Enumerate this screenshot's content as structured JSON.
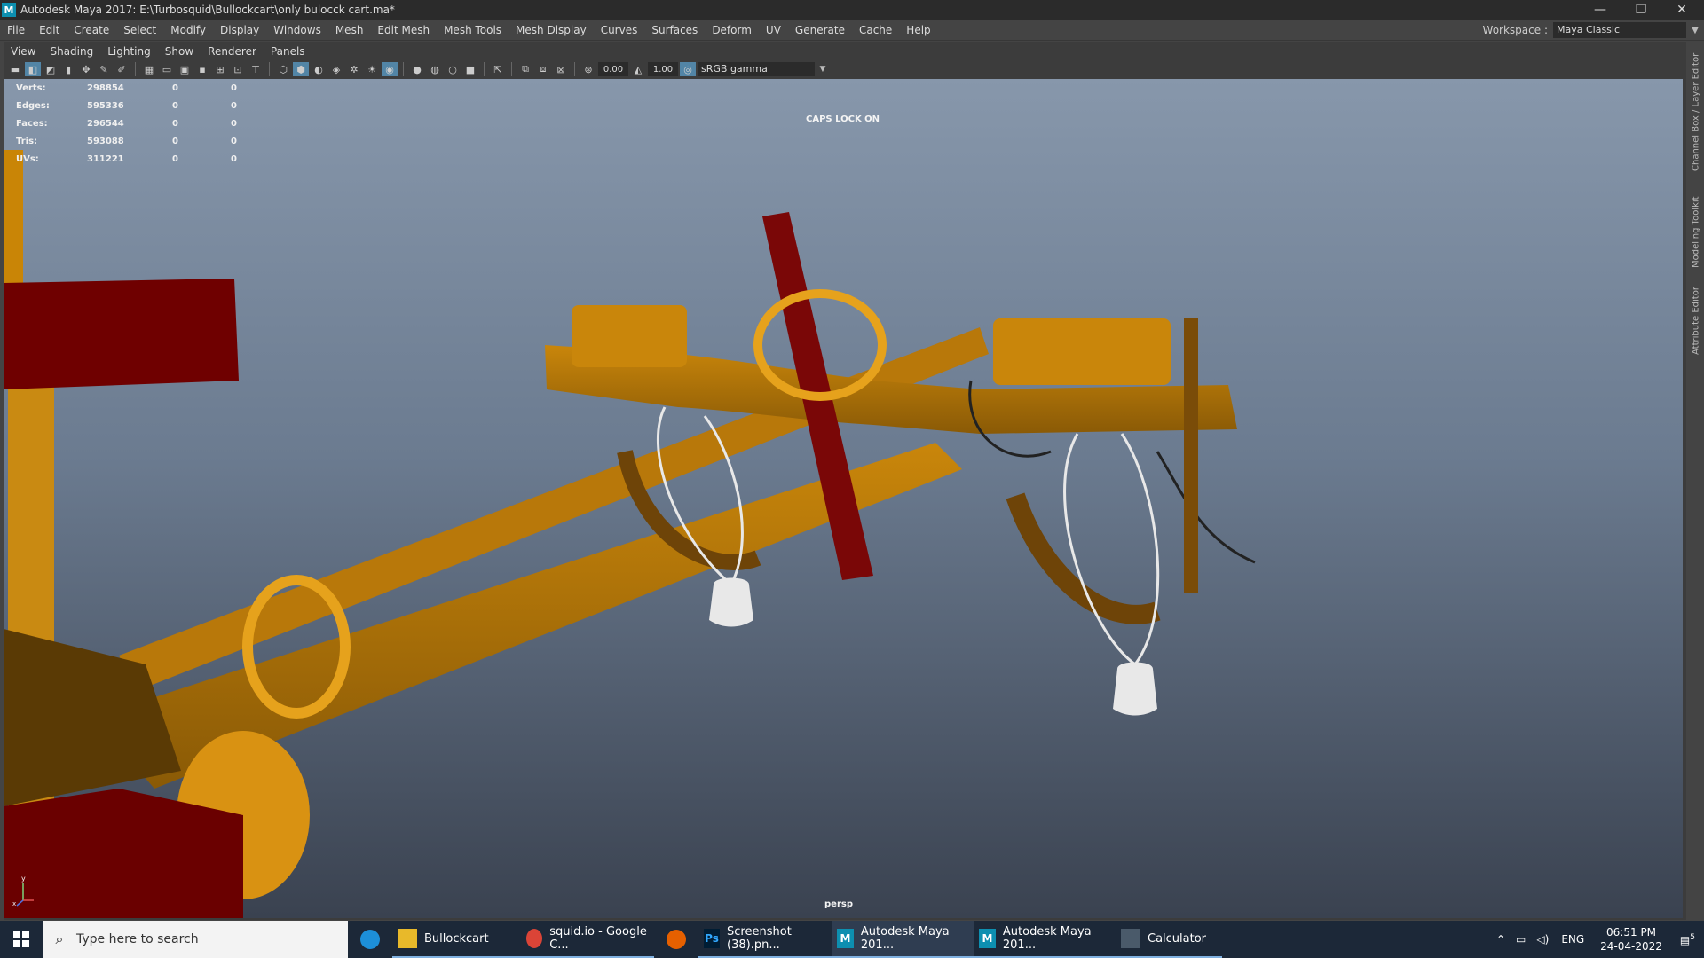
{
  "window": {
    "title": "Autodesk Maya 2017: E:\\Turbosquid\\Bullockcart\\only bulocck cart.ma*",
    "minimize": "—",
    "restore": "❐",
    "close": "✕"
  },
  "menubar": {
    "items": [
      "File",
      "Edit",
      "Create",
      "Select",
      "Modify",
      "Display",
      "Windows",
      "Mesh",
      "Edit Mesh",
      "Mesh Tools",
      "Mesh Display",
      "Curves",
      "Surfaces",
      "Deform",
      "UV",
      "Generate",
      "Cache",
      "Help"
    ],
    "workspace_label": "Workspace :",
    "workspace_value": "Maya Classic"
  },
  "panel_menu": {
    "items": [
      "View",
      "Shading",
      "Lighting",
      "Show",
      "Renderer",
      "Panels"
    ]
  },
  "toolbar": {
    "exposure": "0.00",
    "gamma": "1.00",
    "colorspace": "sRGB gamma"
  },
  "hud": {
    "rows": [
      {
        "label": "Verts:",
        "v1": "298854",
        "v2": "0",
        "v3": "0"
      },
      {
        "label": "Edges:",
        "v1": "595336",
        "v2": "0",
        "v3": "0"
      },
      {
        "label": "Faces:",
        "v1": "296544",
        "v2": "0",
        "v3": "0"
      },
      {
        "label": "Tris:",
        "v1": "593088",
        "v2": "0",
        "v3": "0"
      },
      {
        "label": "UVs:",
        "v1": "311221",
        "v2": "0",
        "v3": "0"
      }
    ],
    "caps_lock": "CAPS LOCK ON",
    "camera": "persp",
    "axis_y": "y",
    "axis_x": "x"
  },
  "side_tabs": {
    "channel_box": "Channel Box / Layer Editor",
    "modeling_toolkit": "Modeling Toolkit",
    "attribute_editor": "Attribute Editor"
  },
  "taskbar": {
    "search_placeholder": "Type here to search",
    "apps": [
      {
        "label": "Bullockcart",
        "icon": "folder-icon"
      },
      {
        "label": "squid.io - Google C...",
        "icon": "chrome-icon"
      },
      {
        "label": "Screenshot (38).pn...",
        "icon": "photoshop-icon"
      },
      {
        "label": "Autodesk Maya 201...",
        "icon": "maya-icon"
      },
      {
        "label": "Autodesk Maya 201...",
        "icon": "maya-icon"
      },
      {
        "label": "Calculator",
        "icon": "calculator-icon"
      }
    ],
    "language": "ENG",
    "time": "06:51 PM",
    "date": "24-04-2022",
    "notifications": "5"
  }
}
